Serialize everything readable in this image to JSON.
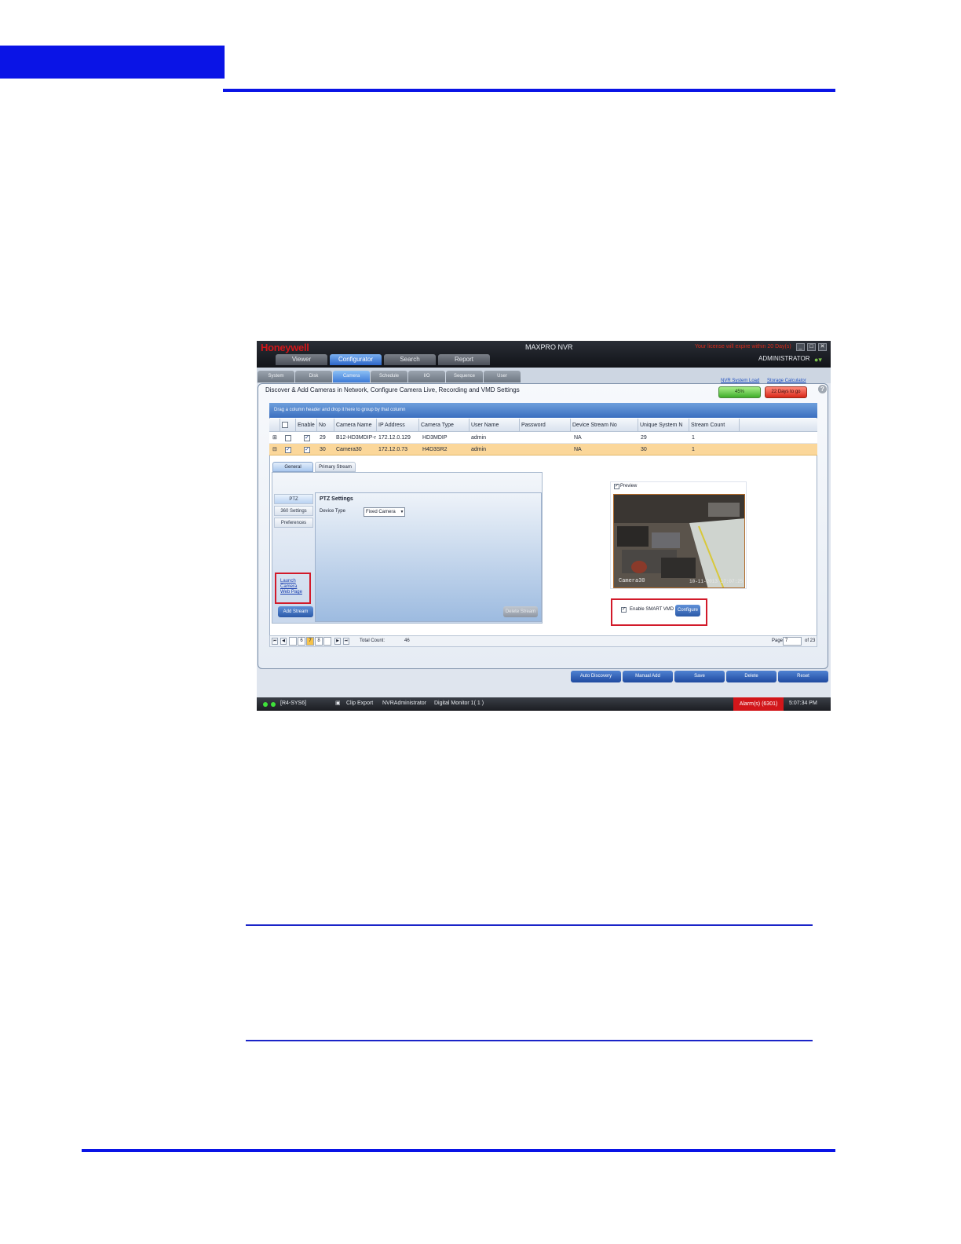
{
  "app": {
    "logo": "Honeywell",
    "title": "MAXPRO NVR",
    "license_msg": "Your license will expire within 20 Day(s)",
    "user": "ADMINISTRATOR",
    "main_tabs": [
      "Viewer",
      "Configurator",
      "Search",
      "Report"
    ],
    "sub_tabs": [
      "System",
      "Disk",
      "Camera",
      "Schedule",
      "I/O",
      "Sequence",
      "User"
    ],
    "headline": "Discover & Add Cameras in Network, Configure Camera Live, Recording and VMD Settings",
    "nvr_load_label": "NVR System Load",
    "nvr_load_value": "45%",
    "storage_label": "Storage Calculator",
    "storage_value": "22 Days to go",
    "group_hint": "Drag a column header and drop it here to group by that column",
    "columns": [
      "Enable",
      "No",
      "Camera Name",
      "IP Address",
      "Camera Type",
      "User Name",
      "Password",
      "Device Stream No",
      "Unique System N",
      "Stream Count"
    ],
    "rows": [
      {
        "no": "29",
        "name": "B12-HD3MDIP-rrv",
        "ip": "172.12.0.129",
        "type": "HD3MDIP",
        "user": "admin",
        "password": "",
        "dev_stream": "NA",
        "unique": "29",
        "count": "1"
      },
      {
        "no": "30",
        "name": "Camera30",
        "ip": "172.12.0.73",
        "type": "H4D3SR2",
        "user": "admin",
        "password": "",
        "dev_stream": "NA",
        "unique": "30",
        "count": "1"
      }
    ],
    "detail_tabs": [
      "General",
      "Primary Stream"
    ],
    "left_nav": [
      "PTZ",
      "360 Settings",
      "Preferences"
    ],
    "ptz_title": "PTZ Settings",
    "device_type_label": "Device Type",
    "device_type_value": "Fixed Camera",
    "launch_lines": [
      "Launch",
      "Camera",
      "Web Page"
    ],
    "add_stream": "Add Stream",
    "delete_stream": "Delete Stream",
    "preview_label": "Preview",
    "video_cam_label": "Camera30",
    "video_time_label": "10-11-2013 17:07:25",
    "enable_vmd": "Enable SMART VMD",
    "configure": "Configure",
    "pager_numbers": [
      "6",
      "7",
      "8"
    ],
    "total_label": "Total Count:",
    "total_value": "46",
    "page_label": "Page",
    "page_value": "7",
    "page_of": "of 23",
    "actions": [
      "Auto Discovery",
      "Manual Add",
      "Save",
      "Delete",
      "Reset"
    ],
    "status": {
      "station": "[R4-SYS6]",
      "clip": "Clip Export",
      "user": "NVRAdministrator",
      "monitor": "Digital Monitor 1( 1 )",
      "alarm": "Alarm(s) (6301)",
      "time": "5:07:34 PM"
    },
    "colors": {
      "accent_blue": "#0a14e6",
      "brand_red": "#d0161a",
      "selected_row": "#fbd79a"
    }
  }
}
